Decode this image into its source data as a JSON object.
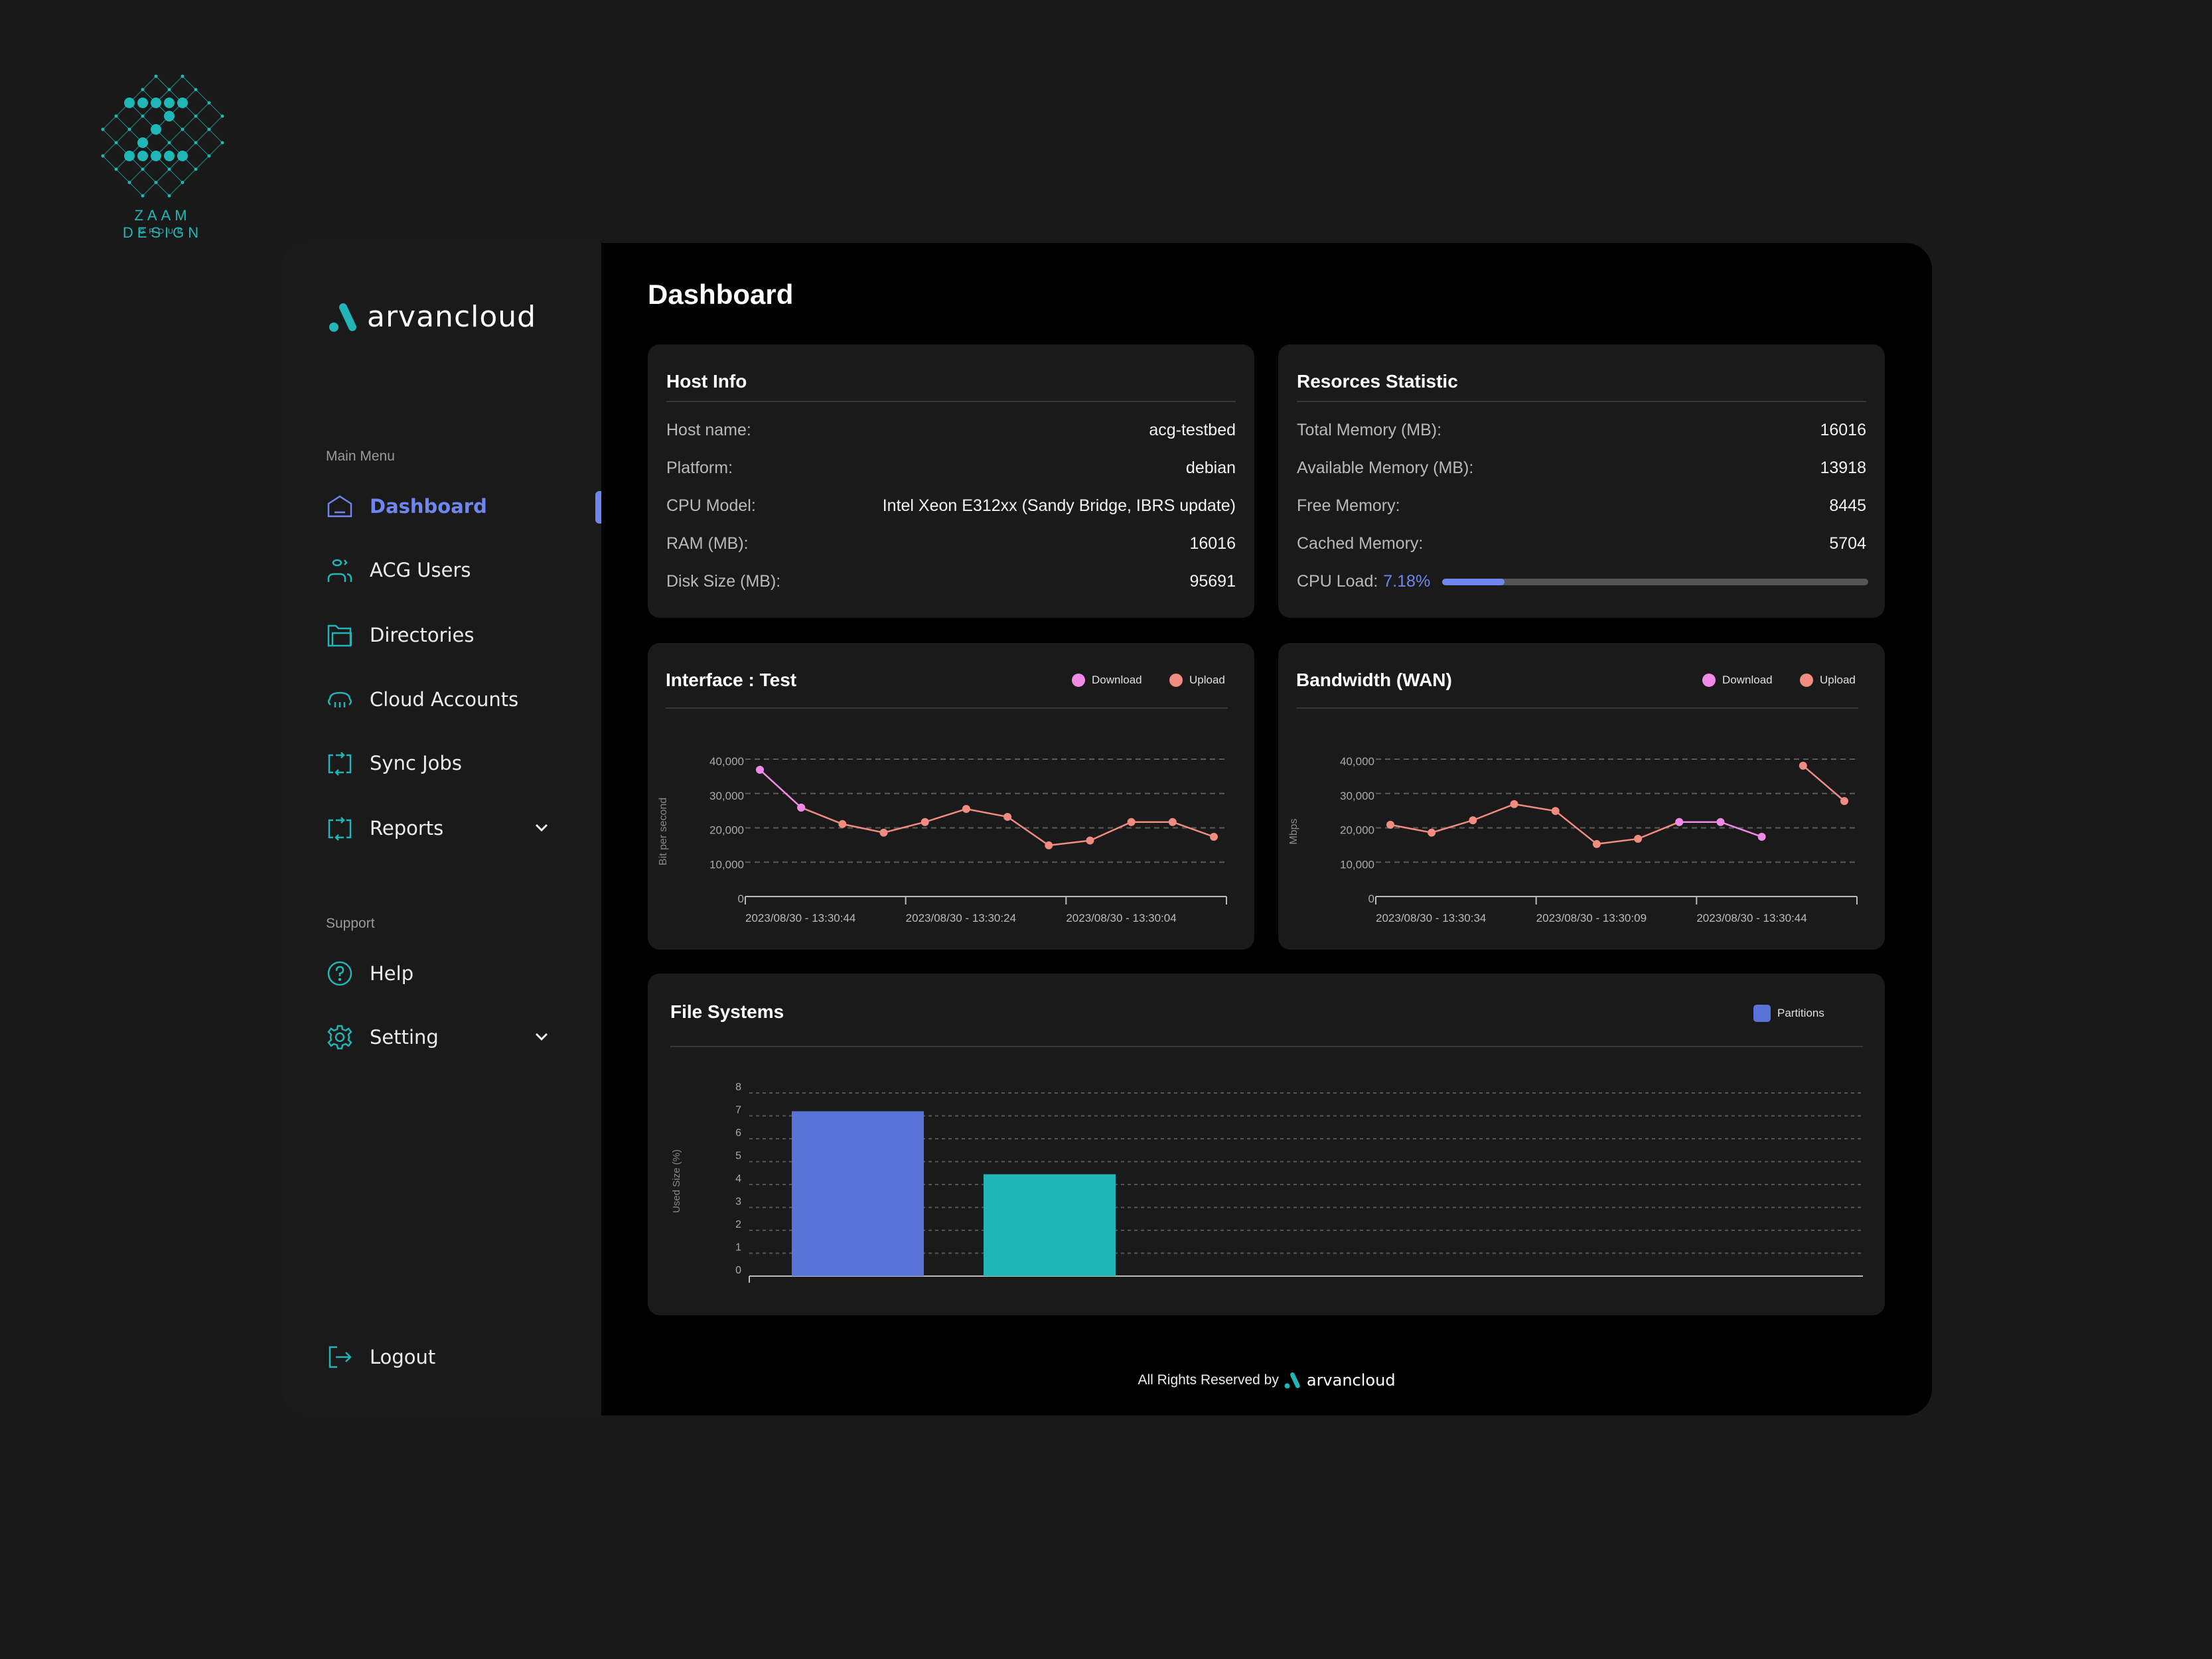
{
  "watermark": {
    "line1": "ZAAM DESIGN",
    "line2": "GROUP"
  },
  "brand": {
    "name": "arvancloud"
  },
  "sidebar": {
    "main_menu_label": "Main Menu",
    "items": [
      {
        "label": "Dashboard",
        "icon": "home-icon",
        "active": true
      },
      {
        "label": "ACG Users",
        "icon": "users-icon"
      },
      {
        "label": "Directories",
        "icon": "folder-icon"
      },
      {
        "label": "Cloud Accounts",
        "icon": "cloud-icon"
      },
      {
        "label": "Sync Jobs",
        "icon": "sync-icon"
      },
      {
        "label": "Reports",
        "icon": "sync-icon",
        "expandable": true
      }
    ],
    "support_label": "Support",
    "support_items": [
      {
        "label": "Help",
        "icon": "help-circle-icon"
      },
      {
        "label": "Setting",
        "icon": "gear-icon",
        "expandable": true
      }
    ],
    "logout_label": "Logout"
  },
  "header": {
    "title": "Dashboard"
  },
  "host_info": {
    "title": "Host Info",
    "rows": [
      {
        "label": "Host name:",
        "value": "acg-testbed"
      },
      {
        "label": "Platform:",
        "value": "debian"
      },
      {
        "label": "CPU Model:",
        "value": "Intel Xeon E312xx (Sandy Bridge, IBRS update)"
      },
      {
        "label": "RAM (MB):",
        "value": "16016"
      },
      {
        "label": "Disk Size (MB):",
        "value": "95691"
      }
    ]
  },
  "resources": {
    "title": "Resorces Statistic",
    "rows": [
      {
        "label": "Total Memory (MB):",
        "value": "16016"
      },
      {
        "label": "Available Memory (MB):",
        "value": "13918"
      },
      {
        "label": "Free Memory:",
        "value": "8445"
      },
      {
        "label": "Cached Memory:",
        "value": "5704"
      }
    ],
    "cpu_label": "CPU Load:",
    "cpu_value": "7.18%",
    "cpu_bar_fill_percent": 14.6
  },
  "colors": {
    "accent": "#6f86ee",
    "teal": "#21b5b8",
    "download": "#f08ae6",
    "upload": "#f08c80",
    "bar1": "#5a73d8",
    "bar2": "#22b5b8"
  },
  "chart_data": [
    {
      "type": "line",
      "title": "Interface : Test",
      "ylabel": "Bit per second",
      "ylim": [
        0,
        40000
      ],
      "yticks": [
        0,
        10000,
        20000,
        30000,
        40000
      ],
      "ytick_labels": [
        "0",
        "10,000",
        "20,000",
        "30,000",
        "40,000"
      ],
      "xtick_labels": [
        "2023/08/30 - 13:30:44",
        "2023/08/30 - 13:30:24",
        "2023/08/30 - 13:30:04"
      ],
      "grid": true,
      "legend": "top-right",
      "series": [
        {
          "name": "Download",
          "values": [
            36900,
            25900,
            null,
            null,
            null,
            null,
            null,
            null,
            null,
            null,
            null,
            null
          ]
        },
        {
          "name": "Upload",
          "values": [
            null,
            25900,
            21100,
            18600,
            21700,
            25500,
            23200,
            14900,
            16300,
            21700,
            21700,
            17400
          ]
        }
      ]
    },
    {
      "type": "line",
      "title": "Bandwidth (WAN)",
      "ylabel": "Mbps",
      "ylim": [
        0,
        40000
      ],
      "yticks": [
        0,
        10000,
        20000,
        30000,
        40000
      ],
      "ytick_labels": [
        "0",
        "10,000",
        "20,000",
        "30,000",
        "40,000"
      ],
      "xtick_labels": [
        "2023/08/30 - 13:30:34",
        "2023/08/30 - 13:30:09",
        "2023/08/30 - 13:30:44"
      ],
      "grid": true,
      "legend": "top-right",
      "series": [
        {
          "name": "Download",
          "values": [
            null,
            null,
            null,
            null,
            null,
            null,
            null,
            21700,
            21700,
            17400,
            null,
            null
          ]
        },
        {
          "name": "Upload",
          "values": [
            20900,
            18600,
            22200,
            26900,
            24900,
            15300,
            16800,
            21700,
            null,
            null,
            38100,
            27800
          ]
        }
      ]
    },
    {
      "type": "bar",
      "title": "File Systems",
      "ylabel": "Used Size (%)",
      "ylim": [
        0,
        8
      ],
      "yticks": [
        0,
        1,
        2,
        3,
        4,
        5,
        6,
        7,
        8
      ],
      "grid": true,
      "legend": "top-right",
      "series": [
        {
          "name": "Partitions",
          "values": [
            7.2,
            4.45
          ]
        }
      ]
    }
  ],
  "footer": {
    "text": "All Rights Reserved by",
    "brand": "arvancloud"
  }
}
